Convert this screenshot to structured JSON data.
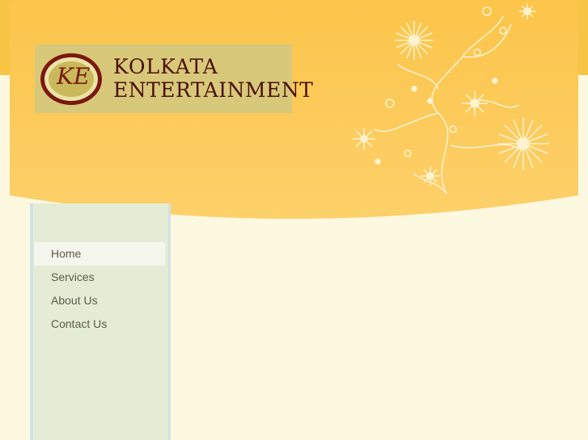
{
  "colors": {
    "page_bg": "#fdf8e0",
    "header_yellow": "#fcc74f",
    "sidebar_bg": "#e5ecd6",
    "nav_active_bg": "#f5f6ee",
    "nav_text": "#5a5a4a",
    "logo_text": "#4a0f0a"
  },
  "logo": {
    "emblem_letters": "KE",
    "line1": "KOLKATA",
    "line2": "ENTERTAINMENT"
  },
  "decoration": {
    "icon": "floral-ornament-icon"
  },
  "nav": {
    "items": [
      {
        "label": "Home",
        "active": true
      },
      {
        "label": "Services",
        "active": false
      },
      {
        "label": "About Us",
        "active": false
      },
      {
        "label": "Contact Us",
        "active": false
      }
    ]
  }
}
